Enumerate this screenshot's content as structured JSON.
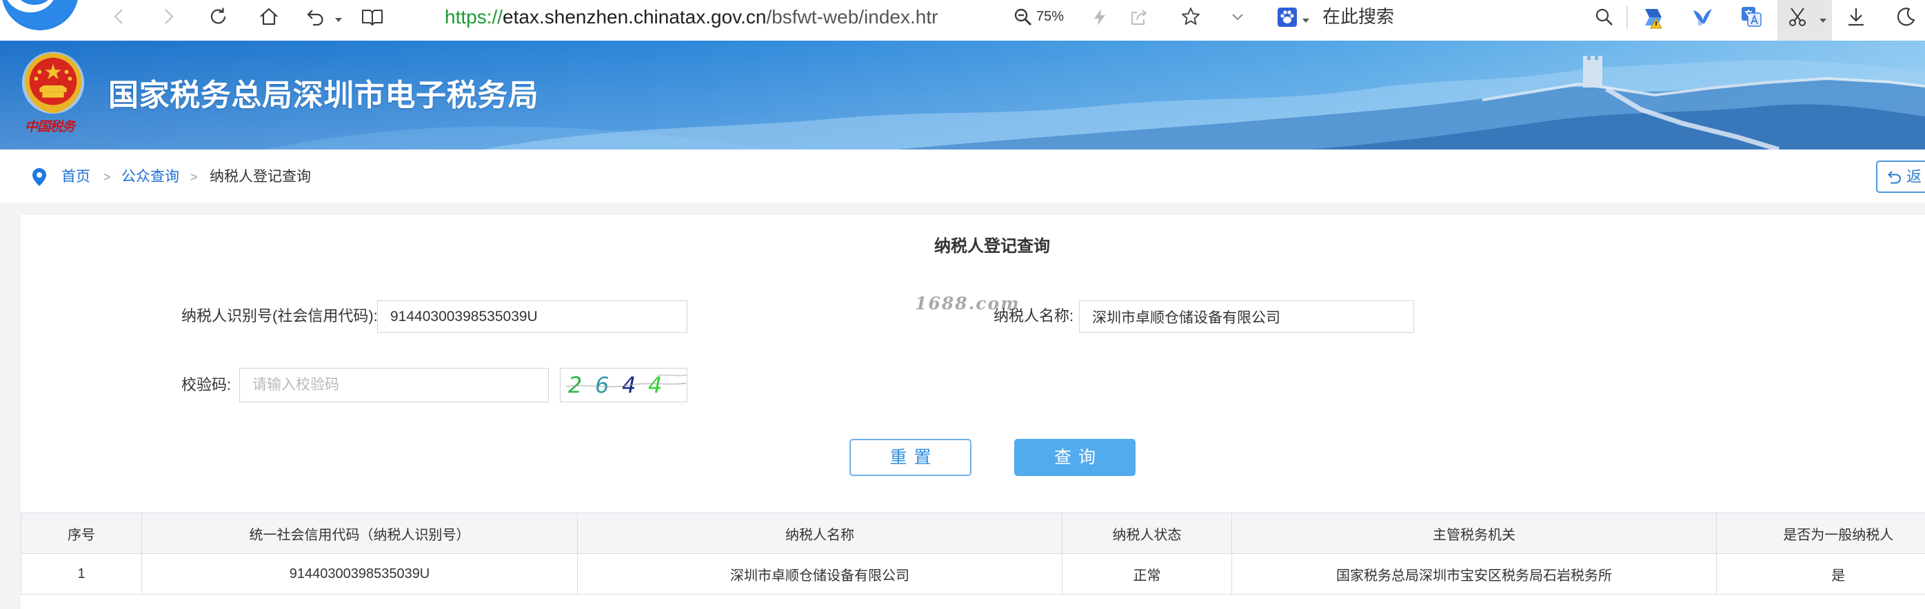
{
  "browser": {
    "url": {
      "scheme": "https://",
      "host": "etax.shenzhen.chinatax.gov.cn",
      "path": "/bsfwt-web/index.htr"
    },
    "zoom": "75%",
    "search_placeholder": "在此搜索",
    "icons": [
      "browser-logo-icon",
      "back-icon",
      "forward-icon",
      "reload-icon",
      "home-icon",
      "undo-icon",
      "reader-icon",
      "zoom-icon",
      "lightning-icon",
      "share-icon",
      "favorite-star-icon",
      "chevron-down-icon",
      "search-engine-paw-icon",
      "search-icon",
      "extension-warning-icon",
      "extension-bird-icon",
      "translate-icon",
      "scissors-icon",
      "download-icon",
      "night-mode-moon-icon"
    ]
  },
  "banner": {
    "title": "国家税务总局深圳市电子税务局",
    "logo_text": "中国税务"
  },
  "breadcrumb": {
    "separator": ">",
    "items": [
      "首页",
      "公众查询",
      "纳税人登记查询"
    ]
  },
  "back_button": {
    "label": "返",
    "icon": "return-arrow-icon"
  },
  "watermark": "1688.com",
  "form": {
    "title": "纳税人登记查询",
    "taxpayer_id": {
      "label": "纳税人识别号(社会信用代码):",
      "value": "91440300398535039U"
    },
    "taxpayer_name": {
      "label": "纳税人名称:",
      "value": "深圳市卓顺仓储设备有限公司"
    },
    "captcha": {
      "label": "校验码:",
      "placeholder": "请输入校验码",
      "image_digits": [
        "2",
        "6",
        "4",
        "4"
      ],
      "digit_colors": [
        "#31b447",
        "#2f97a6",
        "#1b2a86",
        "#36d236"
      ]
    },
    "reset_label": "重置",
    "query_label": "查询"
  },
  "results": {
    "columns": [
      "序号",
      "统一社会信用代码（纳税人识别号）",
      "纳税人名称",
      "纳税人状态",
      "主管税务机关",
      "是否为一般纳税人"
    ],
    "rows": [
      [
        "1",
        "91440300398535039U",
        "深圳市卓顺仓储设备有限公司",
        "正常",
        "国家税务总局深圳市宝安区税务局石岩税务所",
        "是"
      ]
    ]
  },
  "colors": {
    "link": "#1e6fd6",
    "primary_button": "#52abed",
    "primary_border": "#6fb1ea",
    "banner_blue": "#2f88d9",
    "url_scheme": "#1a9b33"
  }
}
